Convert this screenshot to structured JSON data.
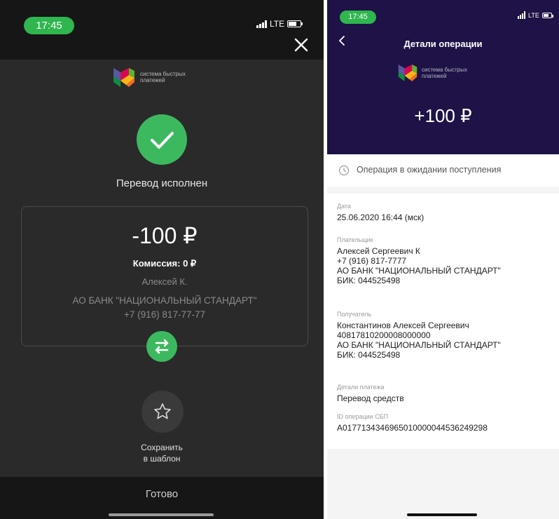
{
  "left": {
    "time": "17:45",
    "network": "LTE",
    "sbp_logo_text": "система быстрых платежей",
    "status": "Перевод исполнен",
    "amount": "-100 ₽",
    "fee_label": "Комиссия:",
    "fee_value": "0 ₽",
    "payee": "Алексей К.",
    "bank": "АО БАНК \"НАЦИОНАЛЬНЫЙ СТАНДАРТ\"",
    "phone": "+7 (916) 817-77-77",
    "save_template": [
      "Сохранить",
      "в шаблон"
    ],
    "done": "Готово"
  },
  "right": {
    "time": "17:45",
    "network": "LTE",
    "title": "Детали операции",
    "sbp_logo_text": "система быстрых платежей",
    "amount": "+100 ₽",
    "pending_status": "Операция в ожидании поступления",
    "date_label": "Дата",
    "date_value": "25.06.2020 16:44 (мск)",
    "payer_label": "Плательщик",
    "payer_lines": [
      "Алексей Сергеевич К",
      "+7 (916) 817-7777",
      "АО БАНК \"НАЦИОНАЛЬНЫЙ СТАНДАРТ\"",
      "БИК: 044525498"
    ],
    "recipient_label": "Получатель",
    "recipient_lines": [
      "Константинов Алексей Сергеевич",
      "40817810200008000000",
      "АО БАНК \"НАЦИОНАЛЬНЫЙ СТАНДАРТ\"",
      "БИК: 044525498"
    ],
    "details_label": "Детали платежа",
    "details_value": "Перевод средств",
    "op_id_label": "ID операции СБП",
    "op_id_value": "A01771343469650100000445362492​98"
  },
  "colors": {
    "success_green": "#3cb95f",
    "header_purple": "#1e1246"
  },
  "icons": {
    "left_close": "close-icon",
    "check": "check-icon",
    "swap": "swap-icon",
    "favorite": "star-icon",
    "back": "chevron-left-icon",
    "pending": "clock-icon"
  }
}
